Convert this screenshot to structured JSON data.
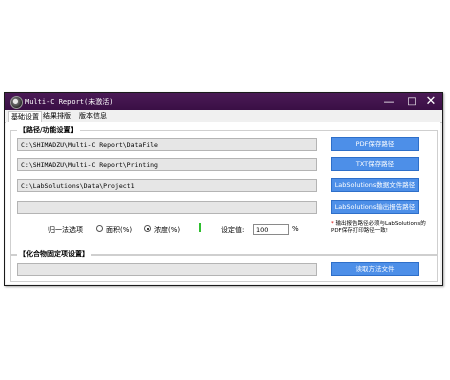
{
  "window": {
    "title": "Multi-C Report(未激活)",
    "controls": {
      "minimize": "—",
      "maximize": "□",
      "close": "✕"
    }
  },
  "tabs": [
    {
      "label": "基础设置"
    },
    {
      "label": "结果排版"
    },
    {
      "label": "版本信息"
    }
  ],
  "path_group": {
    "title": "【路径/功能设置】",
    "rows": [
      {
        "value": "C:\\SHIMADZU\\Multi-C Report\\DataFile",
        "button": "PDF保存路径"
      },
      {
        "value": "C:\\SHIMADZU\\Multi-C Report\\Printing",
        "button": "TXT保存路径"
      },
      {
        "value": "C:\\LabSolutions\\Data\\Project1",
        "button": "LabSolutions数据文件路径"
      },
      {
        "value": "",
        "button": "LabSolutions输出报告路径"
      }
    ],
    "normalize_label": "归一法选项",
    "radio_area": "面积(%)",
    "radio_conc": "浓度(%)",
    "selected": "浓度(%)",
    "set_value_label": "设定值:",
    "set_value": "100",
    "unit": "%",
    "note": "输出报告路径必须与LabSolutions的PDF保存打印路径一致!"
  },
  "compound_group": {
    "title": "【化合物固定项设置】",
    "value": "",
    "button": "读取方法文件"
  },
  "colors": {
    "titlebar": "#3a0f45",
    "button": "#4d8fe8",
    "indicator": "#2fbf2f",
    "note_star": "#d00000"
  }
}
